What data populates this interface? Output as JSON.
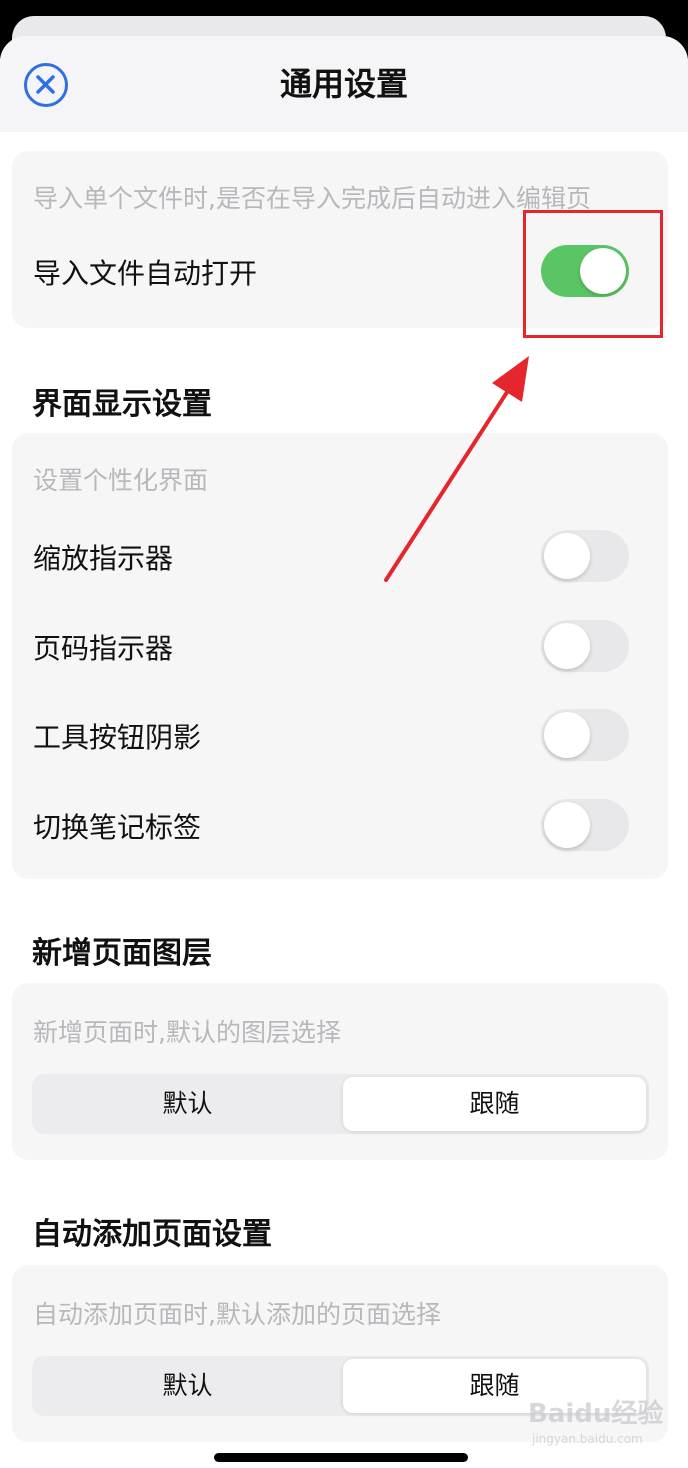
{
  "header": {
    "title": "通用设置",
    "close_icon": "close-circle-icon",
    "accent_color": "#2f6fe4"
  },
  "import_card": {
    "description": "导入单个文件时,是否在导入完成后自动进入编辑页",
    "label": "导入文件自动打开",
    "toggle_on": true
  },
  "display_section": {
    "title": "界面显示设置",
    "description": "设置个性化界面",
    "items": [
      {
        "label": "缩放指示器",
        "toggle_on": false
      },
      {
        "label": "页码指示器",
        "toggle_on": false
      },
      {
        "label": "工具按钮阴影",
        "toggle_on": false
      },
      {
        "label": "切换笔记标签",
        "toggle_on": false
      }
    ]
  },
  "new_page_section": {
    "title": "新增页面图层",
    "description": "新增页面时,默认的图层选择",
    "options": [
      "默认",
      "跟随"
    ],
    "selected": "跟随"
  },
  "auto_add_section": {
    "title": "自动添加页面设置",
    "description": "自动添加页面时,默认添加的页面选择",
    "options": [
      "默认",
      "跟随"
    ],
    "selected": "跟随"
  },
  "annotation": {
    "color": "#e5262d"
  },
  "watermark": {
    "text": "Baidu经验",
    "sub": "jingyan.baidu.com"
  },
  "colors": {
    "toggle_on": "#5ac564",
    "toggle_off": "#e8e8ea",
    "card_bg": "#f6f6f6"
  }
}
